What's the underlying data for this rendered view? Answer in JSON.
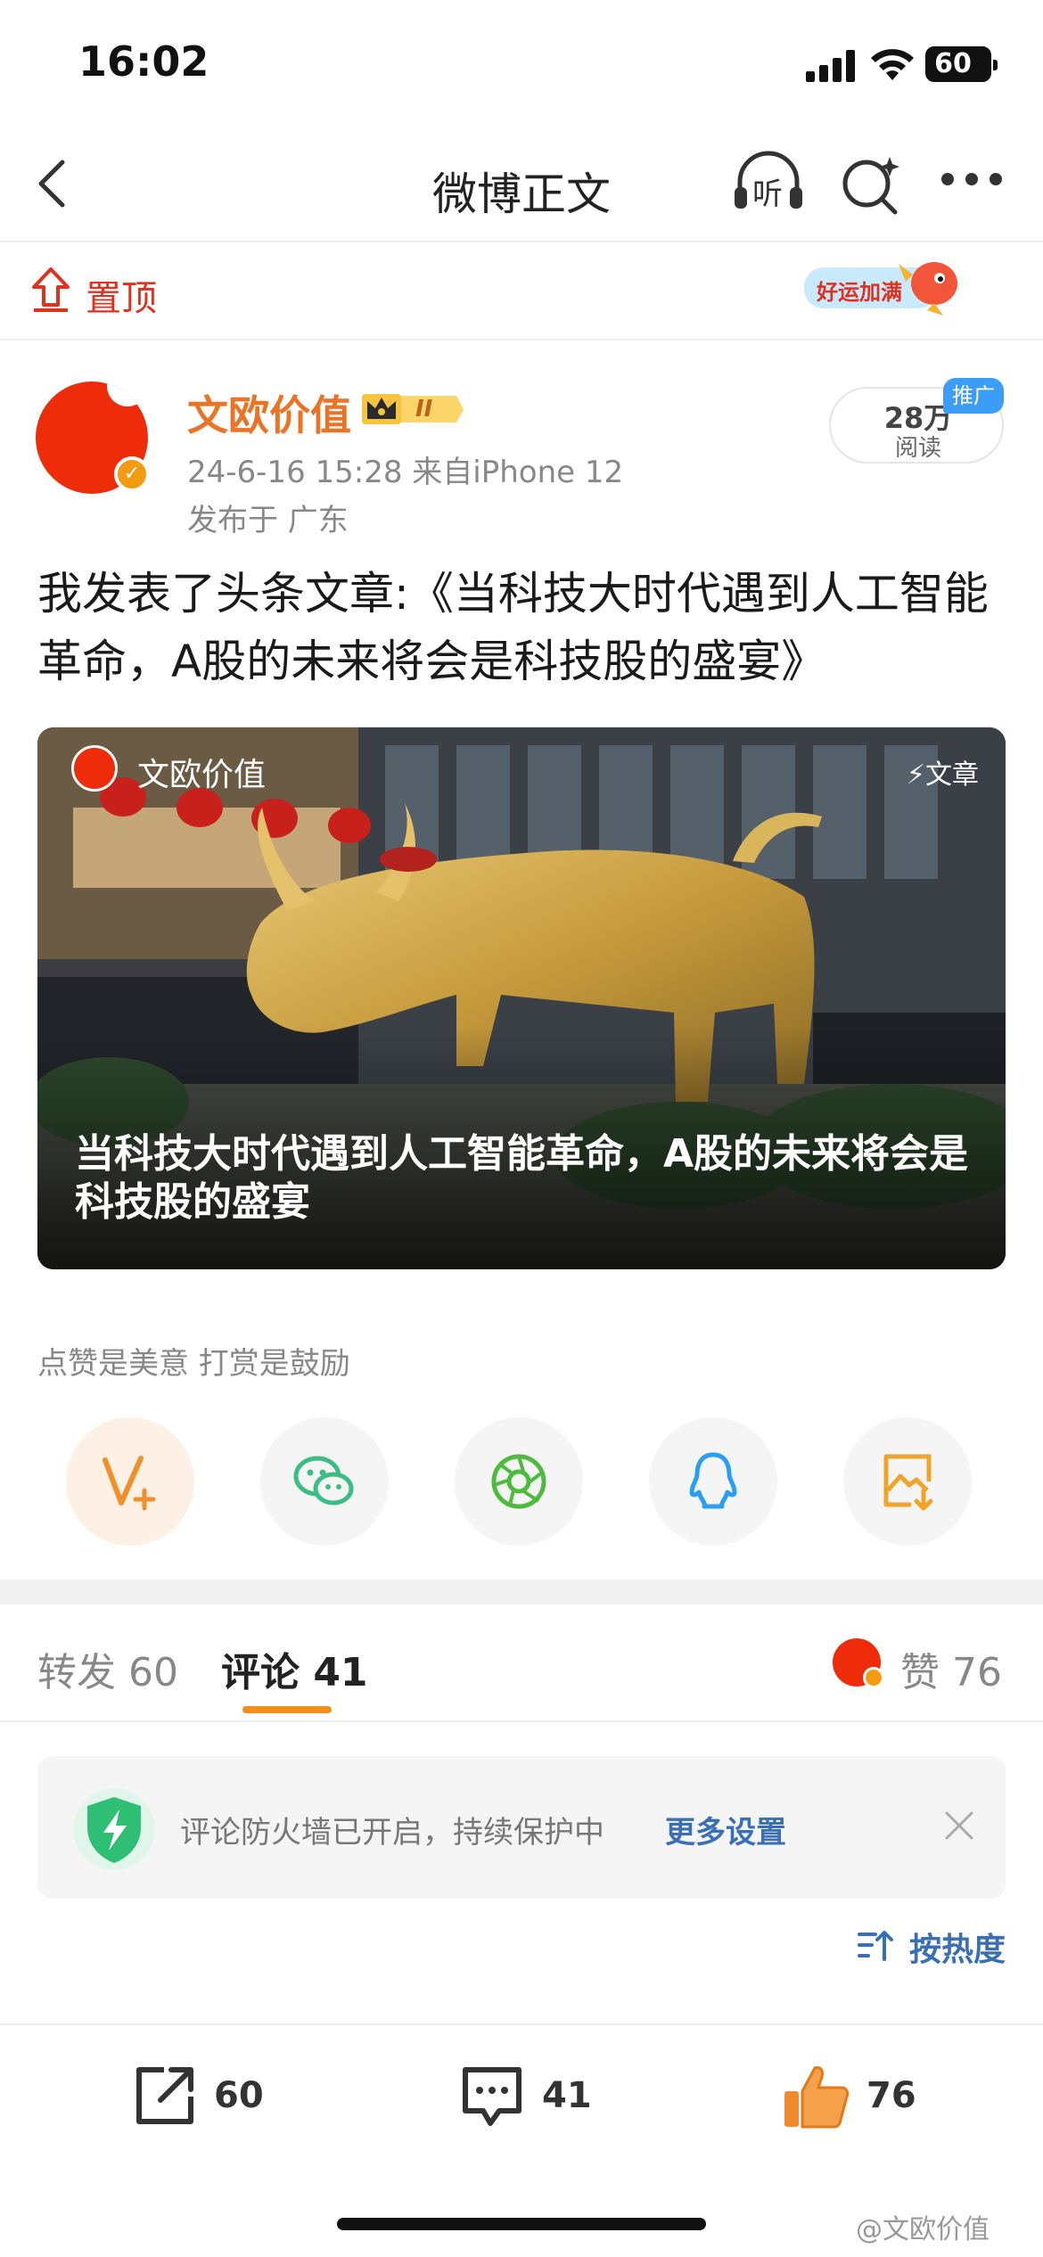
{
  "status_bar": {
    "time": "16:02",
    "battery": "60"
  },
  "nav": {
    "title": "微博正文",
    "listen_label": "听"
  },
  "pinned": {
    "label": "置顶",
    "badge_text": "好运加满"
  },
  "author": {
    "name": "文欧价值",
    "badge_level": "II",
    "meta": "24-6-16 15:28  来自iPhone 12",
    "location": "发布于 广东",
    "reads_count": "28万",
    "reads_label": "阅读",
    "promo_tag": "推广"
  },
  "post": {
    "text": "我发表了头条文章:《当科技大时代遇到人工智能革命，A股的未来将会是科技股的盛宴》"
  },
  "article_card": {
    "author": "文欧价值",
    "tag": "⚡文章",
    "title": "当科技大时代遇到人工智能革命，A股的未来将会是科技股的盛宴"
  },
  "encourage": {
    "label": "点赞是美意  打赏是鼓励"
  },
  "share": {
    "icons": [
      "reward-v-plus-icon",
      "wechat-icon",
      "moments-icon",
      "qq-icon",
      "save-image-icon"
    ]
  },
  "tabs": {
    "forward": "转发 60",
    "comment": "评论 41",
    "likes": "赞 76"
  },
  "firewall": {
    "text": "评论防火墙已开启，持续保护中",
    "link": "更多设置"
  },
  "sort": {
    "label": "按热度"
  },
  "actions": {
    "forward_count": "60",
    "comment_count": "41",
    "like_count": "76"
  },
  "watermark": "@文欧价值",
  "colors": {
    "accent_orange": "#f48e1a",
    "brand_red": "#ef2c0a",
    "link_blue": "#3a6fb5",
    "author_orange": "#eb7325"
  }
}
